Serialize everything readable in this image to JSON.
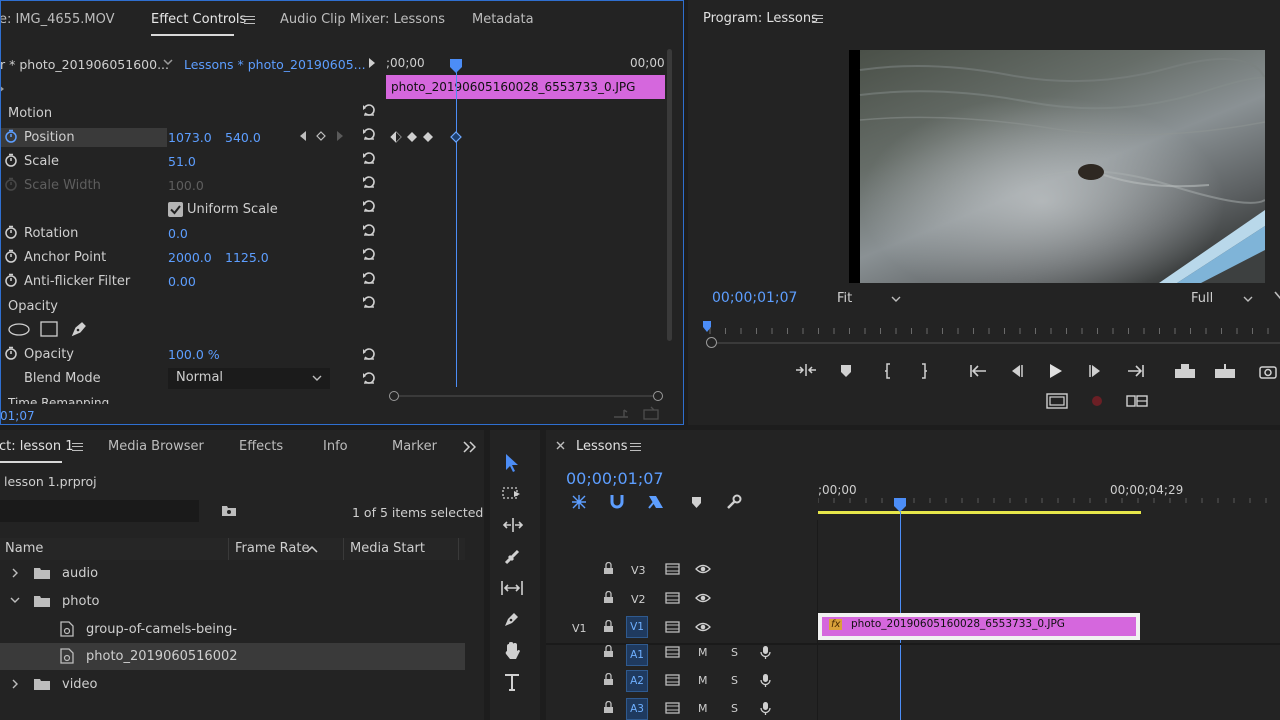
{
  "effect_panel": {
    "tabs": [
      "e: IMG_4655.MOV",
      "Effect Controls",
      "Audio Clip Mixer: Lessons",
      "Metadata"
    ],
    "master_clip": "r * photo_201906051600...",
    "sequence_clip": "Lessons * photo_20190605...",
    "ruler_start": ";00;00",
    "ruler_end": "00;00",
    "clip_bar_label": "photo_20190605160028_6553733_0.JPG",
    "section_motion": "Motion",
    "rows": {
      "position": {
        "label": "Position",
        "v1": "1073.0",
        "v2": "540.0"
      },
      "scale": {
        "label": "Scale",
        "v1": "51.0"
      },
      "scale_width": {
        "label": "Scale Width",
        "v1": "100.0"
      },
      "uniform_scale": {
        "label": "Uniform Scale"
      },
      "rotation": {
        "label": "Rotation",
        "v1": "0.0"
      },
      "anchor_point": {
        "label": "Anchor Point",
        "v1": "2000.0",
        "v2": "1125.0"
      },
      "anti_flicker": {
        "label": "Anti-flicker Filter",
        "v1": "0.00"
      }
    },
    "section_opacity": "Opacity",
    "opacity": {
      "label": "Opacity",
      "v1": "100.0 %"
    },
    "blend_mode": {
      "label": "Blend Mode",
      "value": "Normal"
    },
    "time_remapping": "Time Remapping",
    "footer_time": "01;07"
  },
  "program_monitor": {
    "title": "Program: Lessons",
    "timecode": "00;00;01;07",
    "fit": "Fit",
    "quality": "Full"
  },
  "project_panel": {
    "tabs": [
      "ct: lesson 1",
      "Media Browser",
      "Effects",
      "Info",
      "Markers"
    ],
    "project_file": "lesson 1.prproj",
    "selection_info": "1 of 5 items selected",
    "columns": [
      "Name",
      "Frame Rate",
      "Media Start"
    ],
    "items": [
      {
        "name": "audio",
        "type": "folder",
        "expanded": false
      },
      {
        "name": "photo",
        "type": "folder",
        "expanded": true
      },
      {
        "name": "group-of-camels-being-",
        "type": "image",
        "expanded": false
      },
      {
        "name": "photo_2019060516002",
        "type": "image",
        "expanded": false
      },
      {
        "name": "video",
        "type": "folder",
        "expanded": false
      }
    ]
  },
  "timeline": {
    "title": "Lessons",
    "timecode": "00;00;01;07",
    "ruler_start": ";00;00",
    "ruler_mark": "00;00;04;29",
    "tracks_video": [
      "V3",
      "V2",
      "V1"
    ],
    "source_patch": "V1",
    "tracks_audio": [
      "A1",
      "A2",
      "A3"
    ],
    "mute_label": "M",
    "solo_label": "S",
    "clip_label": "photo_20190605160028_6553733_0.JPG",
    "fx_badge": "fx"
  },
  "colors": {
    "accent_blue": "#5d9eff",
    "clip_pink": "#d567dd",
    "work_area_yellow": "#e6e64a",
    "panel_bg": "#232323"
  }
}
